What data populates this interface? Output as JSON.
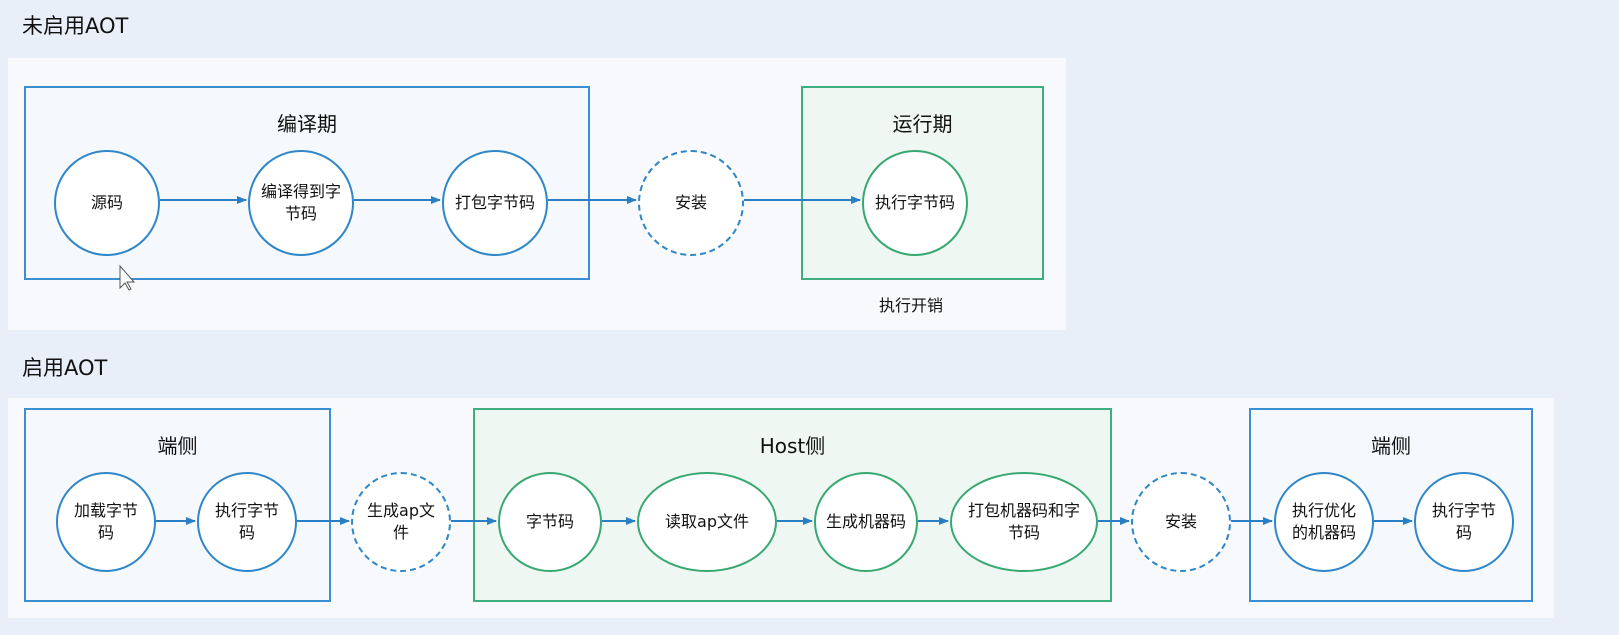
{
  "top": {
    "heading": "未启用AOT",
    "compile_box": {
      "title": "编译期"
    },
    "runtime_box": {
      "title": "运行期"
    },
    "nodes": {
      "source": "源码",
      "compile": "编译得到字节码",
      "package": "打包字节码",
      "install": "安装",
      "execute": "执行字节码"
    },
    "runtime_note": "执行开销"
  },
  "bottom": {
    "heading": "启用AOT",
    "device_left_box": {
      "title": "端侧"
    },
    "host_box": {
      "title": "Host侧"
    },
    "device_right_box": {
      "title": "端侧"
    },
    "nodes": {
      "load": "加载字节码",
      "exec1": "执行字节码",
      "gen_ap": "生成ap文件",
      "bytecode": "字节码",
      "read_ap": "读取ap文件",
      "gen_machine": "生成机器码",
      "pack_both": "打包机器码和字节码",
      "install": "安装",
      "exec_opt": "执行优化的机器码",
      "exec2": "执行字节码"
    }
  },
  "colors": {
    "blue": "#2f86c8",
    "green": "#38a872",
    "arrow": "#2a7fc4"
  }
}
